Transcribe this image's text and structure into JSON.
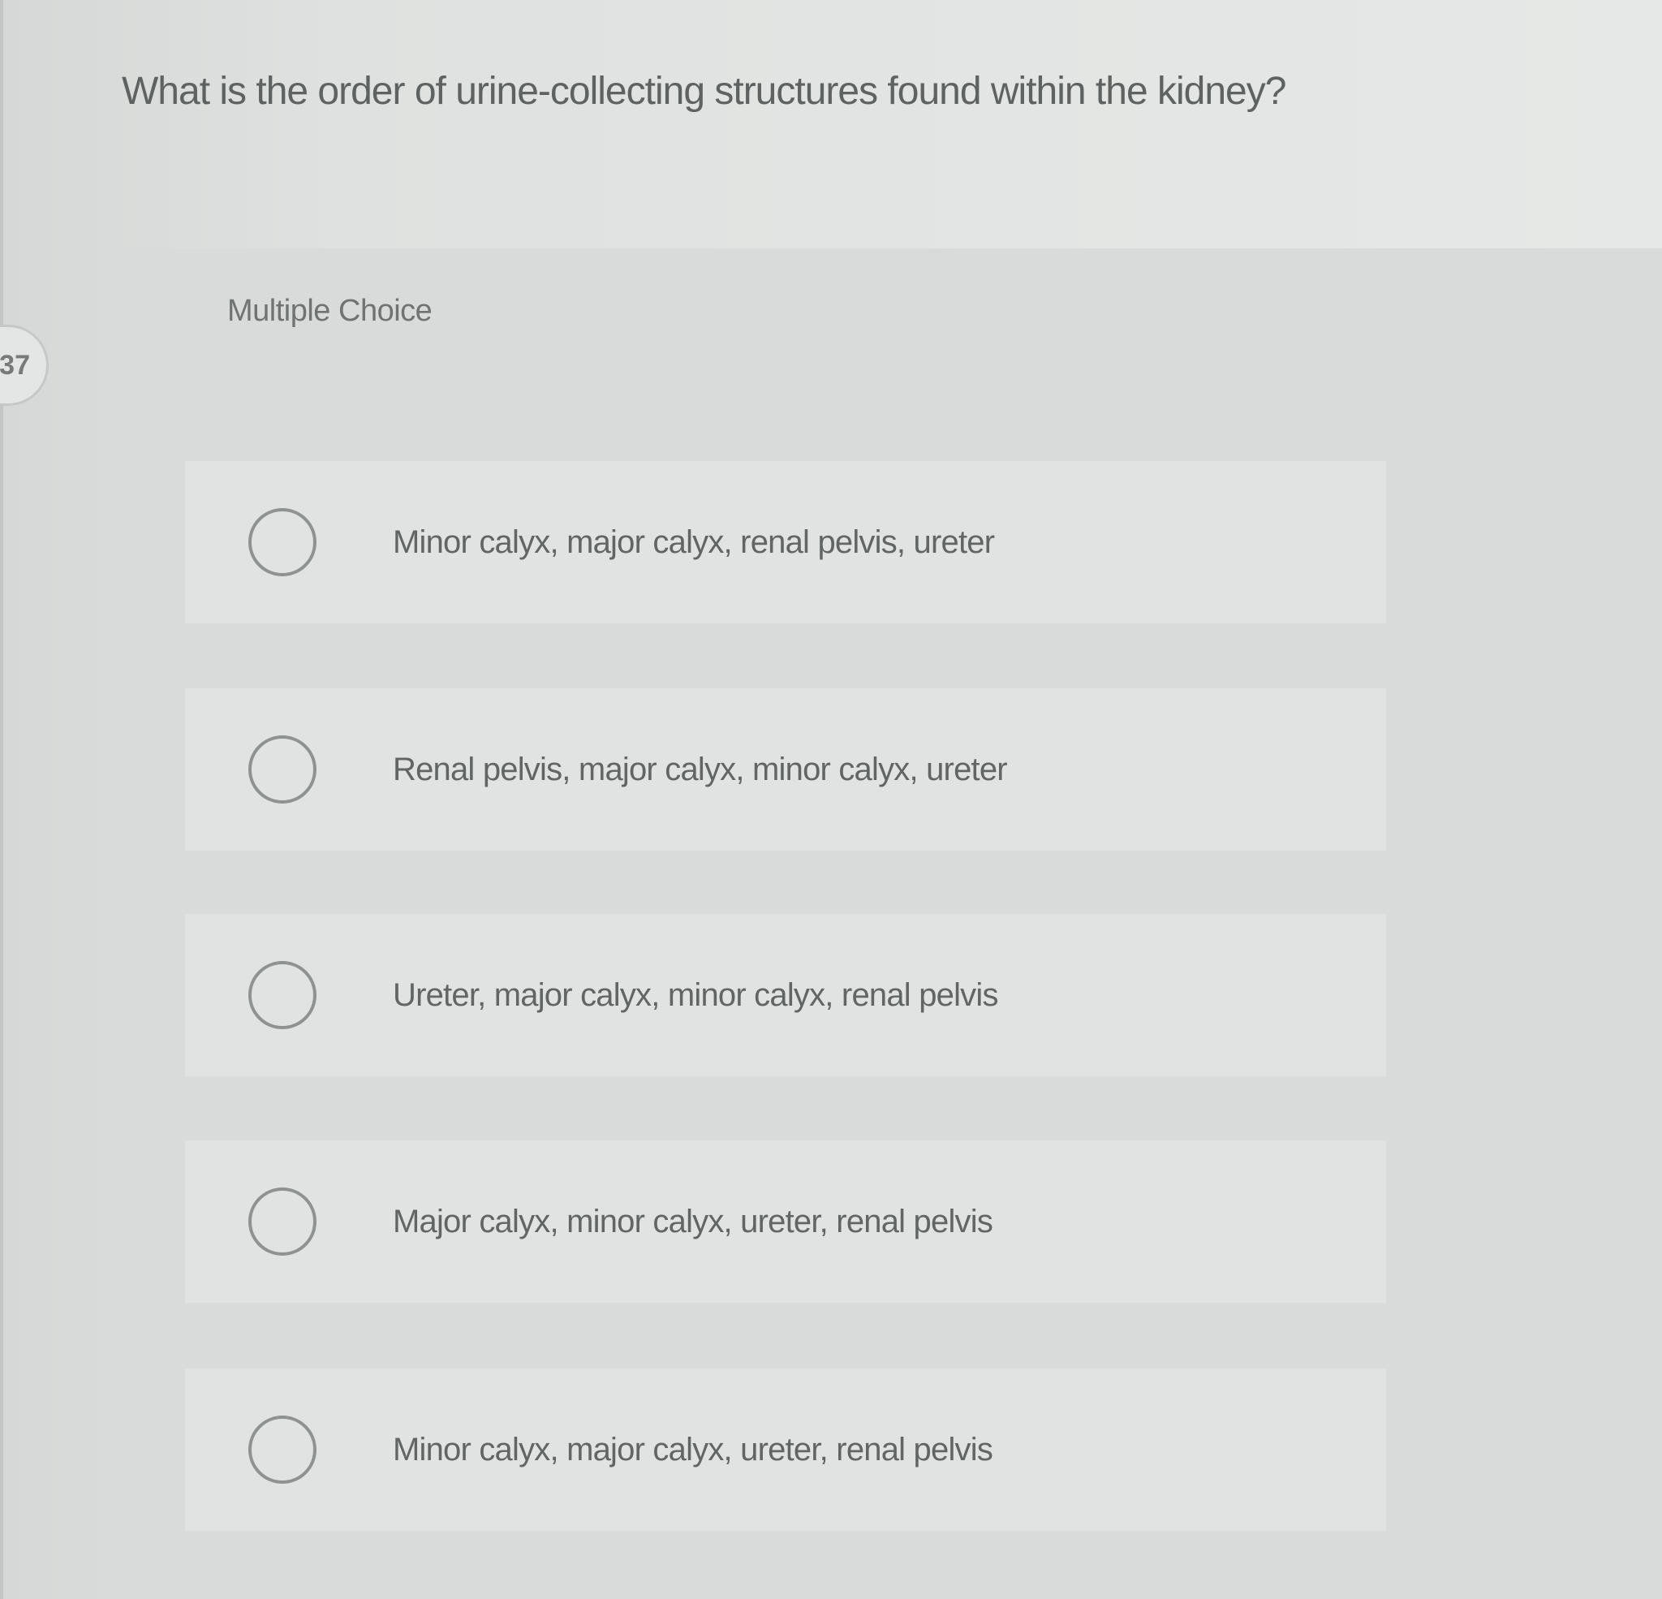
{
  "question": {
    "number": "37",
    "text": "What is the order of urine-collecting structures found within the kidney?"
  },
  "section": {
    "label": "Multiple Choice"
  },
  "choices": [
    {
      "label": "Minor calyx, major calyx, renal pelvis, ureter",
      "selected": false
    },
    {
      "label": "Renal pelvis, major calyx, minor calyx, ureter",
      "selected": false
    },
    {
      "label": "Ureter, major calyx, minor calyx, renal pelvis",
      "selected": false
    },
    {
      "label": "Major calyx, minor calyx, ureter, renal pelvis",
      "selected": false
    },
    {
      "label": "Minor calyx, major calyx, ureter, renal pelvis",
      "selected": false
    }
  ],
  "colors": {
    "background": "#dfe1e0",
    "panel": "#d9dbda",
    "choice_background": "#e1e3e2",
    "text": "#5e6261",
    "radio_border": "#8e9291"
  }
}
